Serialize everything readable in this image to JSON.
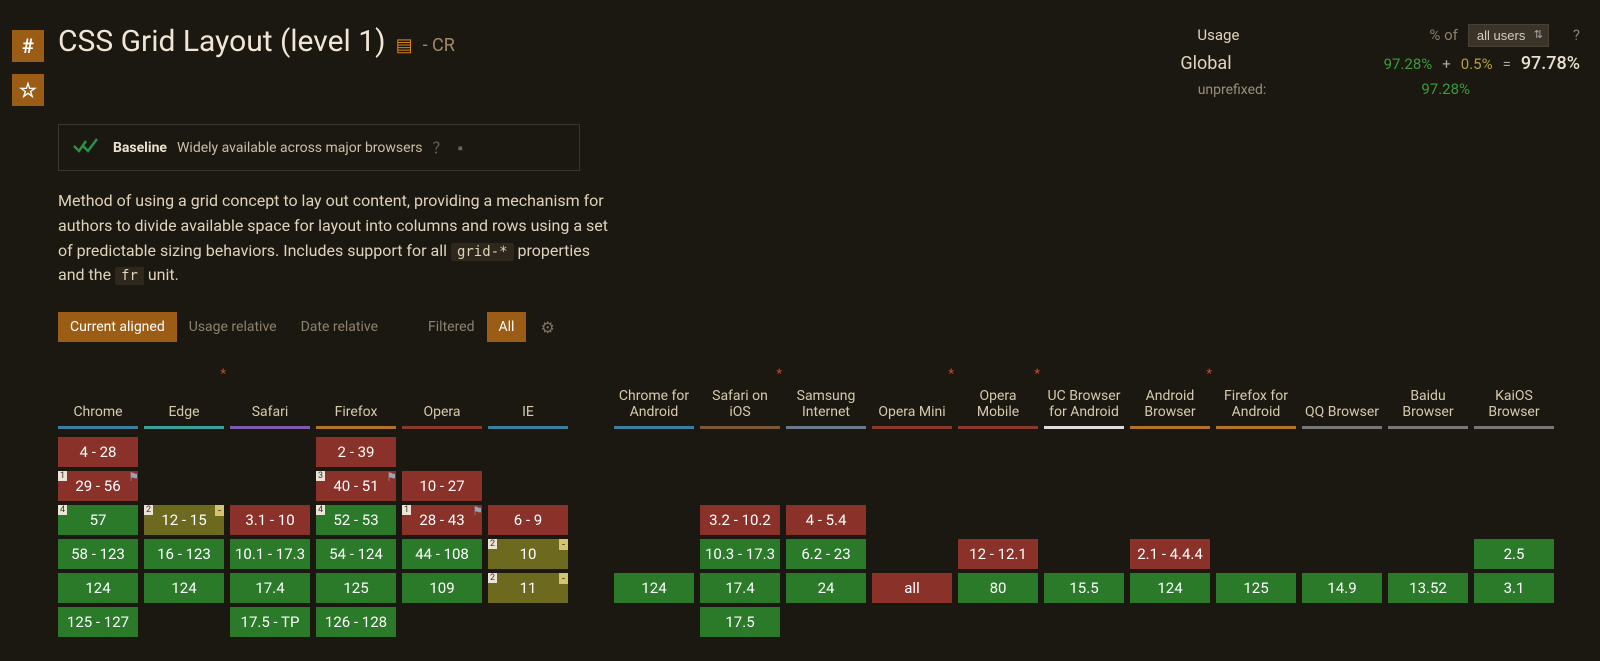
{
  "title": "CSS Grid Layout (level 1)",
  "status_abbr": "- CR",
  "baseline": {
    "label": "Baseline",
    "text": "Widely available across major browsers"
  },
  "description_parts": {
    "p1": "Method of using a grid concept to lay out content, providing a mechanism for authors to divide available space for layout into columns and rows using a set of predictable sizing behaviors. Includes support for all ",
    "code1": "grid-*",
    "p2": " properties and the ",
    "code2": "fr",
    "p3": " unit."
  },
  "tabs": {
    "current": "Current aligned",
    "usage": "Usage relative",
    "date": "Date relative",
    "filtered": "Filtered",
    "all": "All"
  },
  "usage": {
    "usage_label": "Usage",
    "pct_of": "% of",
    "select_value": "all users",
    "global_label": "Global",
    "global_green": "97.28%",
    "plus": "+",
    "global_olive": "0.5%",
    "equals": "=",
    "global_total": "97.78%",
    "unprefixed_label": "unprefixed:",
    "unprefixed_val": "97.28%",
    "question": "?"
  },
  "browsers_a": [
    {
      "name": "Chrome",
      "u": "u-blue",
      "ast": false
    },
    {
      "name": "Edge",
      "u": "u-teal",
      "ast": true
    },
    {
      "name": "Safari",
      "u": "u-purple",
      "ast": false
    },
    {
      "name": "Firefox",
      "u": "u-orange",
      "ast": false
    },
    {
      "name": "Opera",
      "u": "u-dred",
      "ast": false
    },
    {
      "name": "IE",
      "u": "u-blue",
      "ast": false
    }
  ],
  "browsers_b": [
    {
      "name": "Chrome for Android",
      "u": "u-blue",
      "ast": false
    },
    {
      "name": "Safari on iOS",
      "u": "u-brown",
      "ast": true
    },
    {
      "name": "Samsung Internet",
      "u": "u-slate",
      "ast": false
    },
    {
      "name": "Opera Mini",
      "u": "u-dred",
      "ast": true
    },
    {
      "name": "Opera Mobile",
      "u": "u-dred",
      "ast": true
    },
    {
      "name": "UC Browser for Android",
      "u": "u-white",
      "ast": false
    },
    {
      "name": "Android Browser",
      "u": "u-orange",
      "ast": true
    },
    {
      "name": "Firefox for Android",
      "u": "u-orange",
      "ast": false
    },
    {
      "name": "QQ Browser",
      "u": "u-grey",
      "ast": false
    },
    {
      "name": "Baidu Browser",
      "u": "u-grey",
      "ast": false
    },
    {
      "name": "KaiOS Browser",
      "u": "u-grey",
      "ast": false
    }
  ],
  "rows": [
    {
      "a": [
        {
          "t": "4 - 28",
          "s": "s-red"
        },
        null,
        null,
        {
          "t": "2 - 39",
          "s": "s-red"
        },
        null,
        null
      ],
      "b": [
        null,
        null,
        null,
        null,
        null,
        null,
        null,
        null,
        null,
        null,
        null
      ]
    },
    {
      "a": [
        {
          "t": "29 - 56",
          "s": "s-red",
          "note": "1",
          "flag": true
        },
        null,
        null,
        {
          "t": "40 - 51",
          "s": "s-red",
          "note": "3",
          "flag": true
        },
        {
          "t": "10 - 27",
          "s": "s-red"
        },
        null
      ],
      "b": [
        null,
        null,
        null,
        null,
        null,
        null,
        null,
        null,
        null,
        null,
        null
      ]
    },
    {
      "a": [
        {
          "t": "57",
          "s": "s-green",
          "note": "4"
        },
        {
          "t": "12 - 15",
          "s": "s-olive",
          "note": "2",
          "minus": true
        },
        {
          "t": "3.1 - 10",
          "s": "s-red"
        },
        {
          "t": "52 - 53",
          "s": "s-green",
          "note": "4"
        },
        {
          "t": "28 - 43",
          "s": "s-red",
          "note": "1",
          "flag": true
        },
        {
          "t": "6 - 9",
          "s": "s-red"
        }
      ],
      "b": [
        null,
        {
          "t": "3.2 - 10.2",
          "s": "s-red"
        },
        {
          "t": "4 - 5.4",
          "s": "s-red"
        },
        null,
        null,
        null,
        null,
        null,
        null,
        null,
        null
      ]
    },
    {
      "a": [
        {
          "t": "58 - 123",
          "s": "s-green"
        },
        {
          "t": "16 - 123",
          "s": "s-green"
        },
        {
          "t": "10.1 - 17.3",
          "s": "s-green"
        },
        {
          "t": "54 - 124",
          "s": "s-green"
        },
        {
          "t": "44 - 108",
          "s": "s-green"
        },
        {
          "t": "10",
          "s": "s-olive",
          "note": "2",
          "minus": true
        }
      ],
      "b": [
        null,
        {
          "t": "10.3 - 17.3",
          "s": "s-green"
        },
        {
          "t": "6.2 - 23",
          "s": "s-green"
        },
        null,
        {
          "t": "12 - 12.1",
          "s": "s-red"
        },
        null,
        {
          "t": "2.1 - 4.4.4",
          "s": "s-red"
        },
        null,
        null,
        null,
        {
          "t": "2.5",
          "s": "s-green"
        }
      ]
    },
    {
      "a": [
        {
          "t": "124",
          "s": "s-green"
        },
        {
          "t": "124",
          "s": "s-green"
        },
        {
          "t": "17.4",
          "s": "s-green"
        },
        {
          "t": "125",
          "s": "s-green"
        },
        {
          "t": "109",
          "s": "s-green"
        },
        {
          "t": "11",
          "s": "s-olive",
          "note": "2",
          "minus": true
        }
      ],
      "b": [
        {
          "t": "124",
          "s": "s-green"
        },
        {
          "t": "17.4",
          "s": "s-green"
        },
        {
          "t": "24",
          "s": "s-green"
        },
        {
          "t": "all",
          "s": "s-red"
        },
        {
          "t": "80",
          "s": "s-green"
        },
        {
          "t": "15.5",
          "s": "s-green"
        },
        {
          "t": "124",
          "s": "s-green"
        },
        {
          "t": "125",
          "s": "s-green"
        },
        {
          "t": "14.9",
          "s": "s-green"
        },
        {
          "t": "13.52",
          "s": "s-green"
        },
        {
          "t": "3.1",
          "s": "s-green"
        }
      ]
    },
    {
      "a": [
        {
          "t": "125 - 127",
          "s": "s-green"
        },
        null,
        {
          "t": "17.5 - TP",
          "s": "s-green"
        },
        {
          "t": "126 - 128",
          "s": "s-green"
        },
        null,
        null
      ],
      "b": [
        null,
        {
          "t": "17.5",
          "s": "s-green"
        },
        null,
        null,
        null,
        null,
        null,
        null,
        null,
        null,
        null
      ]
    }
  ]
}
